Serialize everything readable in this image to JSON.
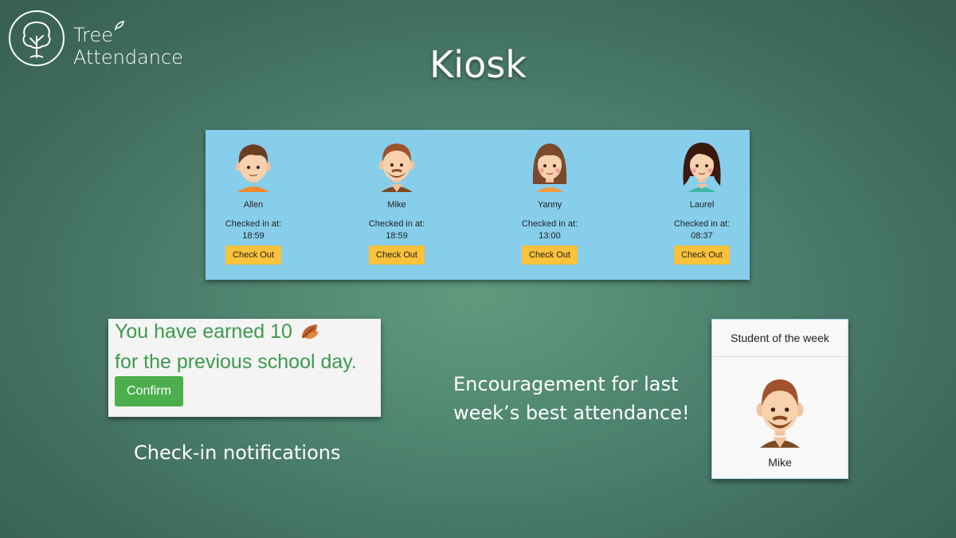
{
  "brand": {
    "line1": "Tree",
    "line2": "Attendance"
  },
  "title": "Kiosk",
  "kiosk": {
    "students": [
      {
        "name": "Allen",
        "checked_label": "Checked in at:",
        "time": "18:59",
        "button": "Check Out",
        "avatar": "boy-avatar-icon"
      },
      {
        "name": "Mike",
        "checked_label": "Checked in at:",
        "time": "18:59",
        "button": "Check Out",
        "avatar": "bearded-man-avatar-icon"
      },
      {
        "name": "Yanny",
        "checked_label": "Checked in at:",
        "time": "13:00",
        "button": "Check Out",
        "avatar": "girl-avatar-icon"
      },
      {
        "name": "Laurel",
        "checked_label": "Checked in at:",
        "time": "08:37",
        "button": "Check Out",
        "avatar": "woman-avatar-icon"
      }
    ]
  },
  "notification": {
    "line1": "You have earned 10",
    "line2": "for the previous school day.",
    "confirm": "Confirm",
    "icon": "leaf-icon"
  },
  "captions": {
    "checkin": "Check-in notifications",
    "encourage_1": "Encouragement for last",
    "encourage_2": "week’s best attendance!"
  },
  "student_of_week": {
    "header": "Student of the week",
    "name": "Mike"
  },
  "colors": {
    "kiosk_bg": "#87ceeb",
    "checkout_button": "#f8c23a",
    "confirm_button": "#4cae4c",
    "notification_text": "#3d9a4b"
  }
}
